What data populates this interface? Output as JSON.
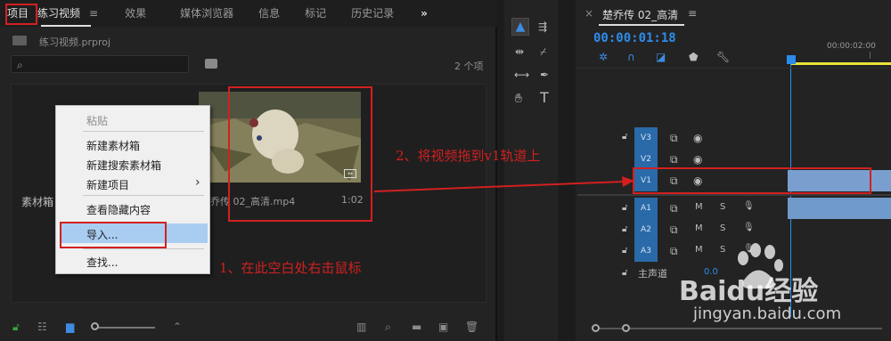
{
  "project_panel": {
    "tabs": [
      "项目",
      "练习视频",
      "效果",
      "媒体浏览器",
      "信息",
      "标记",
      "历史记录"
    ],
    "tab_menu_icon": "≡",
    "overflow_icon": "»",
    "project_file": "练习视频.prproj",
    "item_count": "2 个项",
    "bin_label": "素材箱",
    "clip": {
      "name": "乔传 02_高清.mp4",
      "duration": "1:02"
    }
  },
  "context_menu": {
    "items": [
      "粘贴",
      "新建素材箱",
      "新建搜索素材箱",
      "新建项目",
      "查看隐藏内容",
      "导入...",
      "查找..."
    ],
    "submenu_arrow": "›"
  },
  "annotations": {
    "step1": "1、在此空白处右击鼠标",
    "step2": "2、将视频拖到v1轨道上"
  },
  "timeline": {
    "close_icon": "×",
    "title": "楚乔传 02_高清",
    "menu_icon": "≡",
    "timecode": "00:00:01:18",
    "ruler_time": "00:00:02:00",
    "tracks_video": [
      "V3",
      "V2",
      "V1"
    ],
    "tracks_audio": [
      "A1",
      "A2",
      "A3"
    ],
    "master": "主声道",
    "m_label": "M",
    "s_label": "S",
    "master_value": "0.0"
  },
  "watermark": {
    "brand": "Baidu经验",
    "url": "jingyan.baidu.com"
  },
  "colors": {
    "accent": "#2a6aa8",
    "annotation": "#d22020",
    "timecode": "#2d8ceb"
  }
}
